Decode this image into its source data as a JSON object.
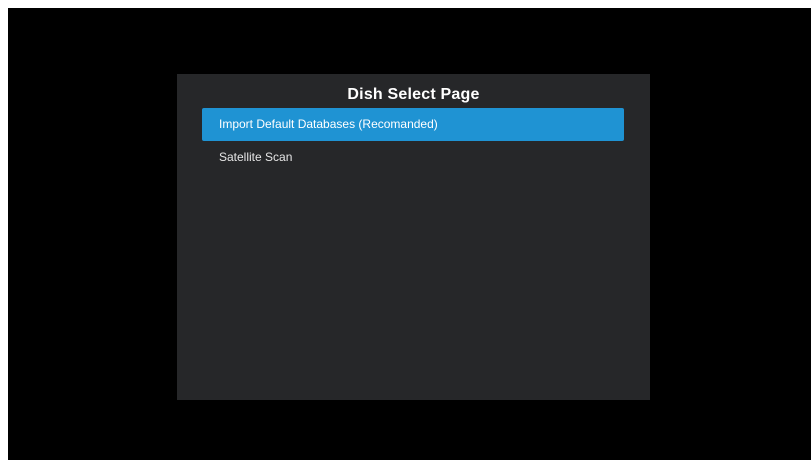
{
  "dialog": {
    "title": "Dish Select Page",
    "items": [
      {
        "label": "Import Default Databases (Recomanded)",
        "selected": true
      },
      {
        "label": "Satellite Scan",
        "selected": false
      }
    ]
  },
  "colors": {
    "background": "#000000",
    "dialog_background": "#262729",
    "selection_accent": "#1f93d3",
    "text": "#ffffff"
  }
}
